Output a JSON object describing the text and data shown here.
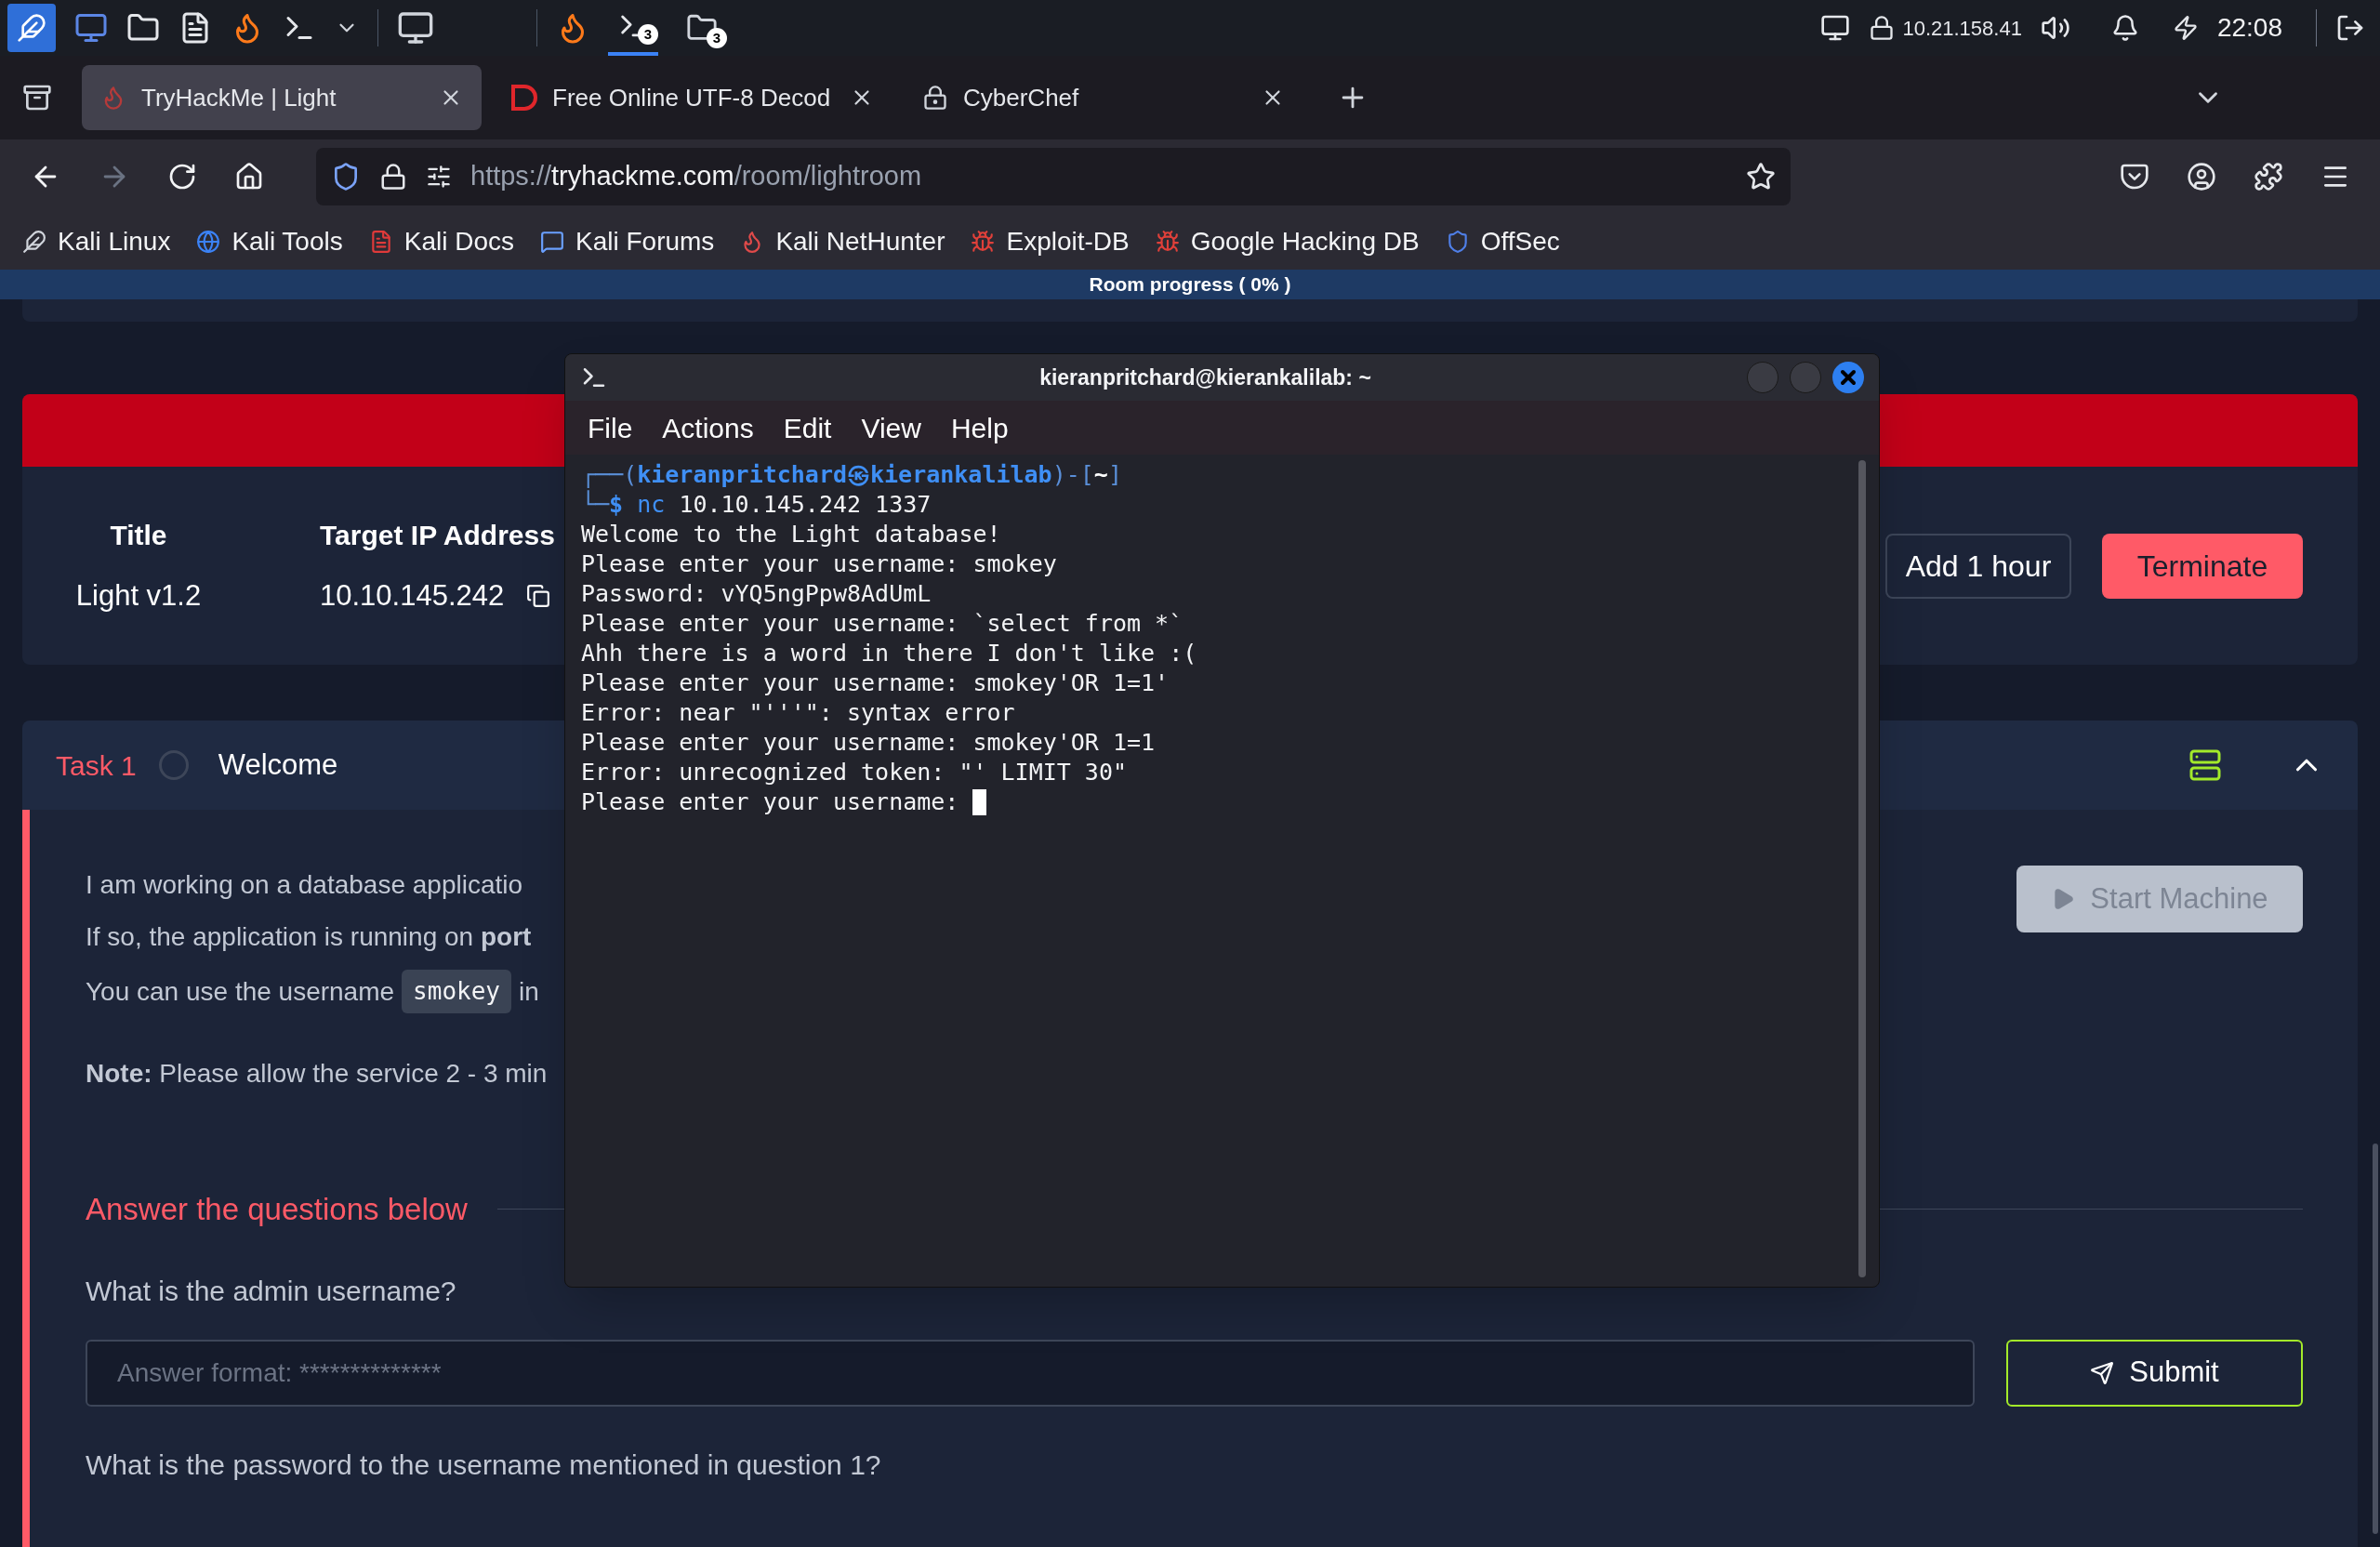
{
  "taskbar": {
    "apps": [
      {
        "kind": "terminal",
        "badge": "3",
        "active": true
      },
      {
        "kind": "folder",
        "badge": "3",
        "active": false
      }
    ],
    "ip": "10.21.158.41",
    "clock": "22:08"
  },
  "browser": {
    "tabs": [
      {
        "kind": "thm",
        "title": "TryHackMe | Light",
        "selected": true
      },
      {
        "kind": "dcode",
        "title": "Free Online UTF-8 Decod",
        "selected": false
      },
      {
        "kind": "chef",
        "title": "CyberChef",
        "selected": false
      }
    ],
    "url": {
      "scheme": "https://",
      "domain": "tryhackme.com",
      "path": "/room/lightroom"
    },
    "bookmarks": [
      {
        "kind": "kali",
        "label": "Kali Linux"
      },
      {
        "kind": "tools",
        "label": "Kali Tools"
      },
      {
        "kind": "docs",
        "label": "Kali Docs"
      },
      {
        "kind": "forums",
        "label": "Kali Forums"
      },
      {
        "kind": "nethunter",
        "label": "Kali NetHunter"
      },
      {
        "kind": "exploit",
        "label": "Exploit-DB"
      },
      {
        "kind": "exploit",
        "label": "Google Hacking DB"
      },
      {
        "kind": "offsec",
        "label": "OffSec"
      }
    ]
  },
  "progress": {
    "label": "Room progress ( 0% )",
    "level": 0
  },
  "machine": {
    "columns": [
      {
        "kind": "plain",
        "label": "Title",
        "value": "Light v1.2"
      },
      {
        "kind": "copyable",
        "label": "Target IP Address",
        "value": "10.10.145.242"
      }
    ],
    "buttons": [
      {
        "kind": "outline",
        "label": "Add 1 hour"
      },
      {
        "kind": "danger",
        "label": "Terminate"
      }
    ]
  },
  "task": {
    "number": "Task 1",
    "title": "Welcome",
    "done": false,
    "expanded": true,
    "paragraphs": [
      [
        {
          "kind": "text",
          "text": "I am working on a database applicatio"
        }
      ],
      [
        {
          "kind": "text",
          "text": "If so, the application is running on **port**"
        }
      ],
      [
        {
          "kind": "text",
          "text": "You can use the username"
        },
        {
          "kind": "code",
          "text": "smokey"
        },
        {
          "kind": "text",
          "text": "in"
        }
      ],
      [
        {
          "kind": "text",
          "text": "**Note:** Please allow the service 2 - 3 min"
        }
      ]
    ],
    "start_button": {
      "label": "Start Machine",
      "disabled": true
    },
    "answers_heading": "Answer the questions below",
    "questions": [
      {
        "question": "What is the admin username?",
        "placeholder": "Answer format: **************",
        "button": "Submit"
      },
      {
        "question": "What is the password to the username mentioned in question 1?"
      }
    ]
  },
  "terminal": {
    "title": "kieranpritchard@kierankalilab: ~",
    "menu": [
      "File",
      "Actions",
      "Edit",
      "View",
      "Help"
    ],
    "prompt": {
      "open": "┌──(",
      "user": "kieranpritchard",
      "at": "㉿",
      "host": "kierankalilab",
      "mid": ")-[",
      "dir": "~",
      "close": "]"
    },
    "command": {
      "corner": "└─",
      "sign": "$",
      "program": "nc",
      "args": "10.10.145.242 1337"
    },
    "lines": [
      "Welcome to the Light database!",
      "Please enter your username: smokey",
      "Password: vYQ5ngPpw8AdUmL",
      "Please enter your username: `select from *`",
      "Ahh there is a word in there I don't like :(",
      "Please enter your username: smokey'OR 1=1'",
      "Error: near \"'''\": syntax error",
      "Please enter your username: smokey'OR 1=1",
      "Error: unrecognized token: \"' LIMIT 30\""
    ],
    "input_line": "Please enter your username:"
  }
}
